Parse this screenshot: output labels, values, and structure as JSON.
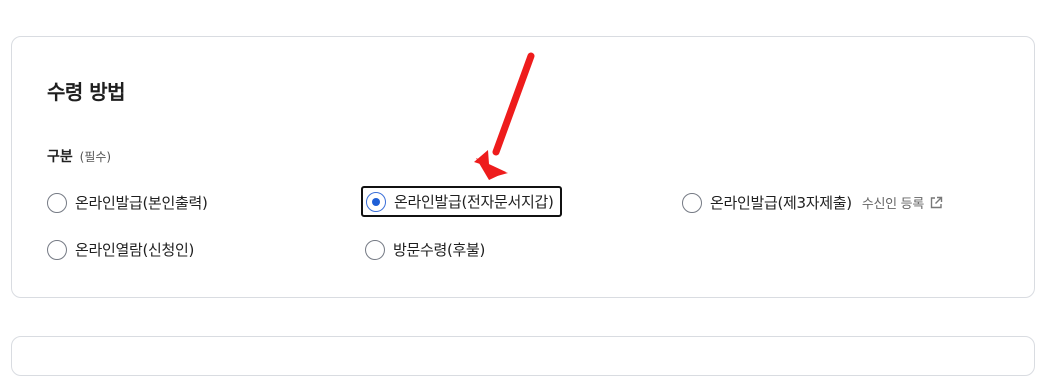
{
  "section": {
    "title": "수령 방법",
    "group_label": "구분",
    "required_label": "(필수)"
  },
  "options": [
    {
      "label": "온라인발급(본인출력)",
      "checked": false
    },
    {
      "label": "온라인발급(전자문서지갑)",
      "checked": true
    },
    {
      "label": "온라인발급(제3자제출)",
      "checked": false,
      "extra": "수신인 등록",
      "extra_icon": "external-link-icon"
    },
    {
      "label": "온라인열람(신청인)",
      "checked": false
    },
    {
      "label": "방문수령(후불)",
      "checked": false
    }
  ],
  "colors": {
    "accent": "#1f5fd6",
    "annotation_arrow": "#ee1c1c",
    "border": "#d9dce1"
  }
}
